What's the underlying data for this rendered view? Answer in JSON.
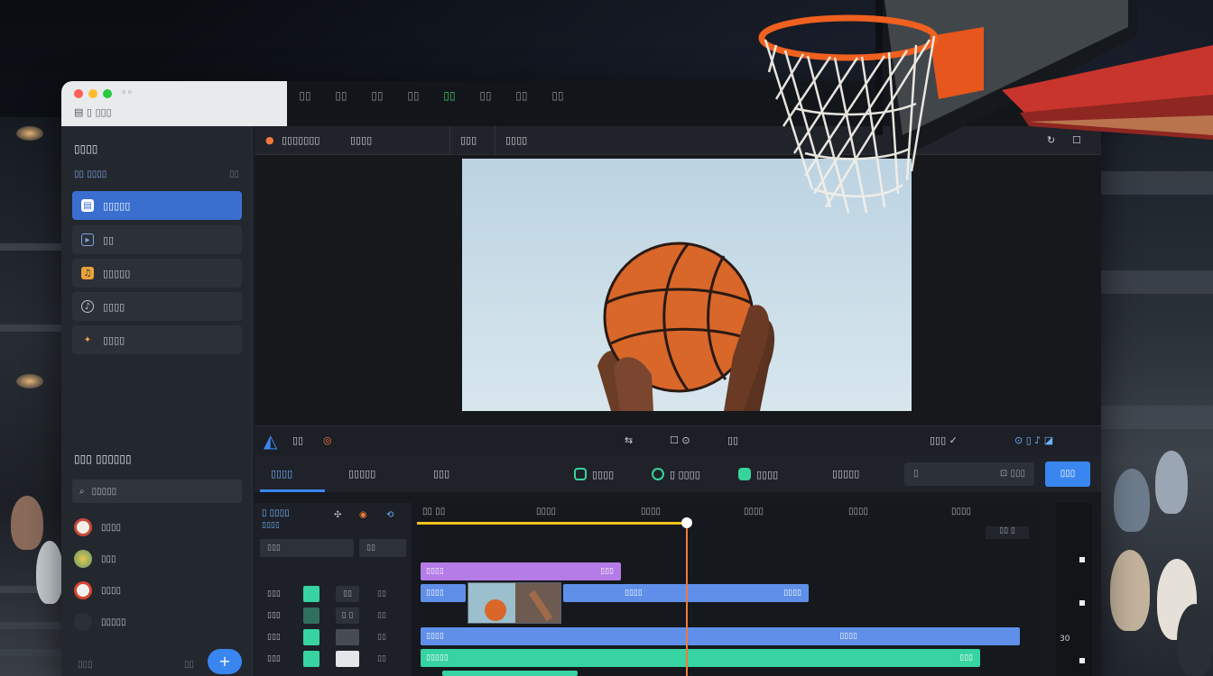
{
  "page": {
    "title": ""
  },
  "window": {
    "title_tabs": [
      "◦◦",
      "▯▯",
      "▯▯",
      "▯▯",
      "▯▯",
      "▯▯",
      "▯▯",
      "▯▯",
      "▯▯"
    ],
    "address": "▤  ▯  ▯▯▯"
  },
  "sidebar": {
    "heading": "▯▯▯▯",
    "sub_label": "▯▯ ▯▯▯▯",
    "sub_count": "▯▯",
    "items": [
      {
        "label": "▯▯▯▯▯",
        "icon": "document-icon",
        "active": true
      },
      {
        "label": "▯▯",
        "icon": "play-icon",
        "active": false
      },
      {
        "label": "▯▯▯▯▯",
        "icon": "music-icon",
        "active": false
      },
      {
        "label": "▯▯▯▯",
        "icon": "audio-icon",
        "active": false
      },
      {
        "label": "▯▯▯▯",
        "icon": "effects-icon",
        "active": false
      }
    ],
    "section2_heading": "▯▯▯ ▯▯▯▯▯▯",
    "search_value": "▯▯▯▯▯",
    "contacts": [
      {
        "label": "▯▯▯▯",
        "color": "#f2efe8"
      },
      {
        "label": "▯▯▯",
        "color": "#d8b44a"
      },
      {
        "label": "▯▯▯▯",
        "color": "#f1f1f1"
      },
      {
        "label": "▯▯▯▯▯",
        "color": "#2b2f36"
      }
    ],
    "footer_text": "▯▯▯",
    "footer_icon_text": "▯▯",
    "fab_label": "+"
  },
  "editor": {
    "header": {
      "project": "▯▯▯▯▯▯▯",
      "mode": "▯▯▯▯",
      "menu1": "▯▯▯",
      "menu2": "▯▯▯▯"
    },
    "toolbar": {
      "brand": "▯▯",
      "time": "▯▯",
      "center1": "⇆",
      "center2": "☐  ⊙",
      "center3": "▯▯",
      "right1": "▯▯▯ ✓",
      "right2": "⊙ ▯ ♪ ◪"
    },
    "tabs": [
      {
        "label": "▯▯▯▯"
      },
      {
        "label": "▯▯▯▯▯"
      },
      {
        "label": "▯▯▯"
      }
    ],
    "tools": [
      {
        "label": "▯▯▯▯"
      },
      {
        "label": "▯ ▯▯▯▯"
      },
      {
        "label": "▯▯▯▯"
      },
      {
        "label": "▯▯▯▯▯"
      }
    ],
    "search_placeholder": "▯",
    "search_value": "▯▯▯",
    "action_button": "▯▯▯"
  },
  "timeline": {
    "panel_title": "▯ ▯▯▯▯",
    "panel_sub": "▯▯▯▯",
    "box1": "▯▯▯",
    "box2": "▯▯",
    "ruler": [
      "▯▯ ▯▯",
      "▯▯▯▯",
      "▯▯▯▯",
      "▯▯▯▯",
      "▯▯▯▯",
      "▯▯▯▯"
    ],
    "ruler_end": "▯▯ ▯",
    "rows": [
      {
        "label": "▯▯▯",
        "swatch": "#37d3a0",
        "btn": "▯▯",
        "val": "▯▯"
      },
      {
        "label": "▯▯▯",
        "swatch": "#2f6f5e",
        "btn": "▯ ▯",
        "val": "▯▯"
      },
      {
        "label": "▯▯▯",
        "swatch": "#37d3a0",
        "btn": "",
        "val": "▯▯"
      },
      {
        "label": "▯▯▯",
        "swatch": "#37d3a0",
        "btn": "",
        "val": "▯▯"
      }
    ],
    "clips": [
      {
        "track": 0,
        "label": "▯▯▯▯",
        "label2": "▯▯▯",
        "color": "#b57be6"
      },
      {
        "track": 1,
        "label": "▯▯▯▯",
        "label2": "",
        "color": "#5f8fe8"
      },
      {
        "track": 1,
        "label": "▯▯▯▯",
        "label2": "▯▯▯▯",
        "color": "#5f8fe8"
      },
      {
        "track": 2,
        "label": "▯▯▯▯",
        "label2": "▯▯▯▯",
        "color": "#5f8fe8"
      },
      {
        "track": 3,
        "label": "▯▯▯▯▯",
        "label2": "▯▯▯",
        "color": "#37d3a0"
      }
    ],
    "scroll_number": "30"
  },
  "colors": {
    "accent": "#3a86f0",
    "playhead": "#f07a3c",
    "scrub": "#f0c21c"
  }
}
